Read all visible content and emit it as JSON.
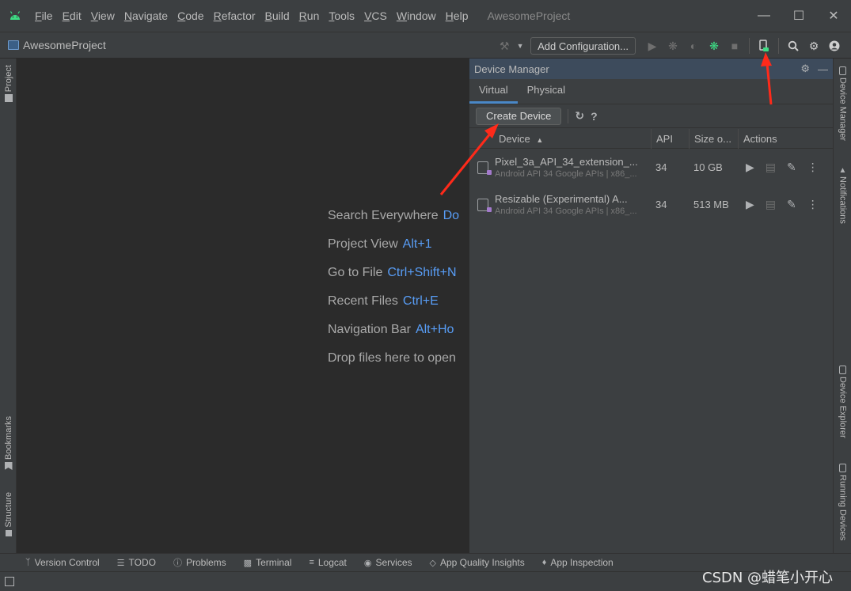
{
  "menubar": {
    "items": [
      "File",
      "Edit",
      "View",
      "Navigate",
      "Code",
      "Refactor",
      "Build",
      "Run",
      "Tools",
      "VCS",
      "Window",
      "Help"
    ],
    "title": "AwesomeProject"
  },
  "toolbar": {
    "project_name": "AwesomeProject",
    "add_configuration_label": "Add Configuration..."
  },
  "left_stripe": {
    "project_label": "Project",
    "bookmarks_label": "Bookmarks",
    "structure_label": "Structure"
  },
  "editor": {
    "hints": [
      {
        "label": "Search Everywhere",
        "shortcut": "Do"
      },
      {
        "label": "Project View",
        "shortcut": "Alt+1"
      },
      {
        "label": "Go to File",
        "shortcut": "Ctrl+Shift+N"
      },
      {
        "label": "Recent Files",
        "shortcut": "Ctrl+E"
      },
      {
        "label": "Navigation Bar",
        "shortcut": "Alt+Ho"
      },
      {
        "label": "Drop files here to open",
        "shortcut": ""
      }
    ]
  },
  "device_manager": {
    "title": "Device Manager",
    "tabs": [
      "Virtual",
      "Physical"
    ],
    "active_tab": "Virtual",
    "create_device_label": "Create Device",
    "help_label": "?",
    "columns": [
      "Device",
      "API",
      "Size o...",
      "Actions"
    ],
    "rows": [
      {
        "name": "Pixel_3a_API_34_extension_...",
        "details": "Android API 34 Google APIs | x86_...",
        "api": "34",
        "size": "10 GB"
      },
      {
        "name": "Resizable (Experimental) A...",
        "details": "Android API 34 Google APIs | x86_...",
        "api": "34",
        "size": "513 MB"
      }
    ]
  },
  "right_stripe": {
    "device_manager_label": "Device Manager",
    "notifications_label": "Notifications",
    "device_explorer_label": "Device Explorer",
    "running_devices_label": "Running Devices"
  },
  "bottom_tabs": [
    "Version Control",
    "TODO",
    "Problems",
    "Terminal",
    "Logcat",
    "Services",
    "App Quality Insights",
    "App Inspection"
  ],
  "watermark": "CSDN @蜡笔小开心",
  "colors": {
    "accent": "#589df6",
    "android_green": "#3ddc84",
    "annotation_red": "#ff2a1a"
  }
}
